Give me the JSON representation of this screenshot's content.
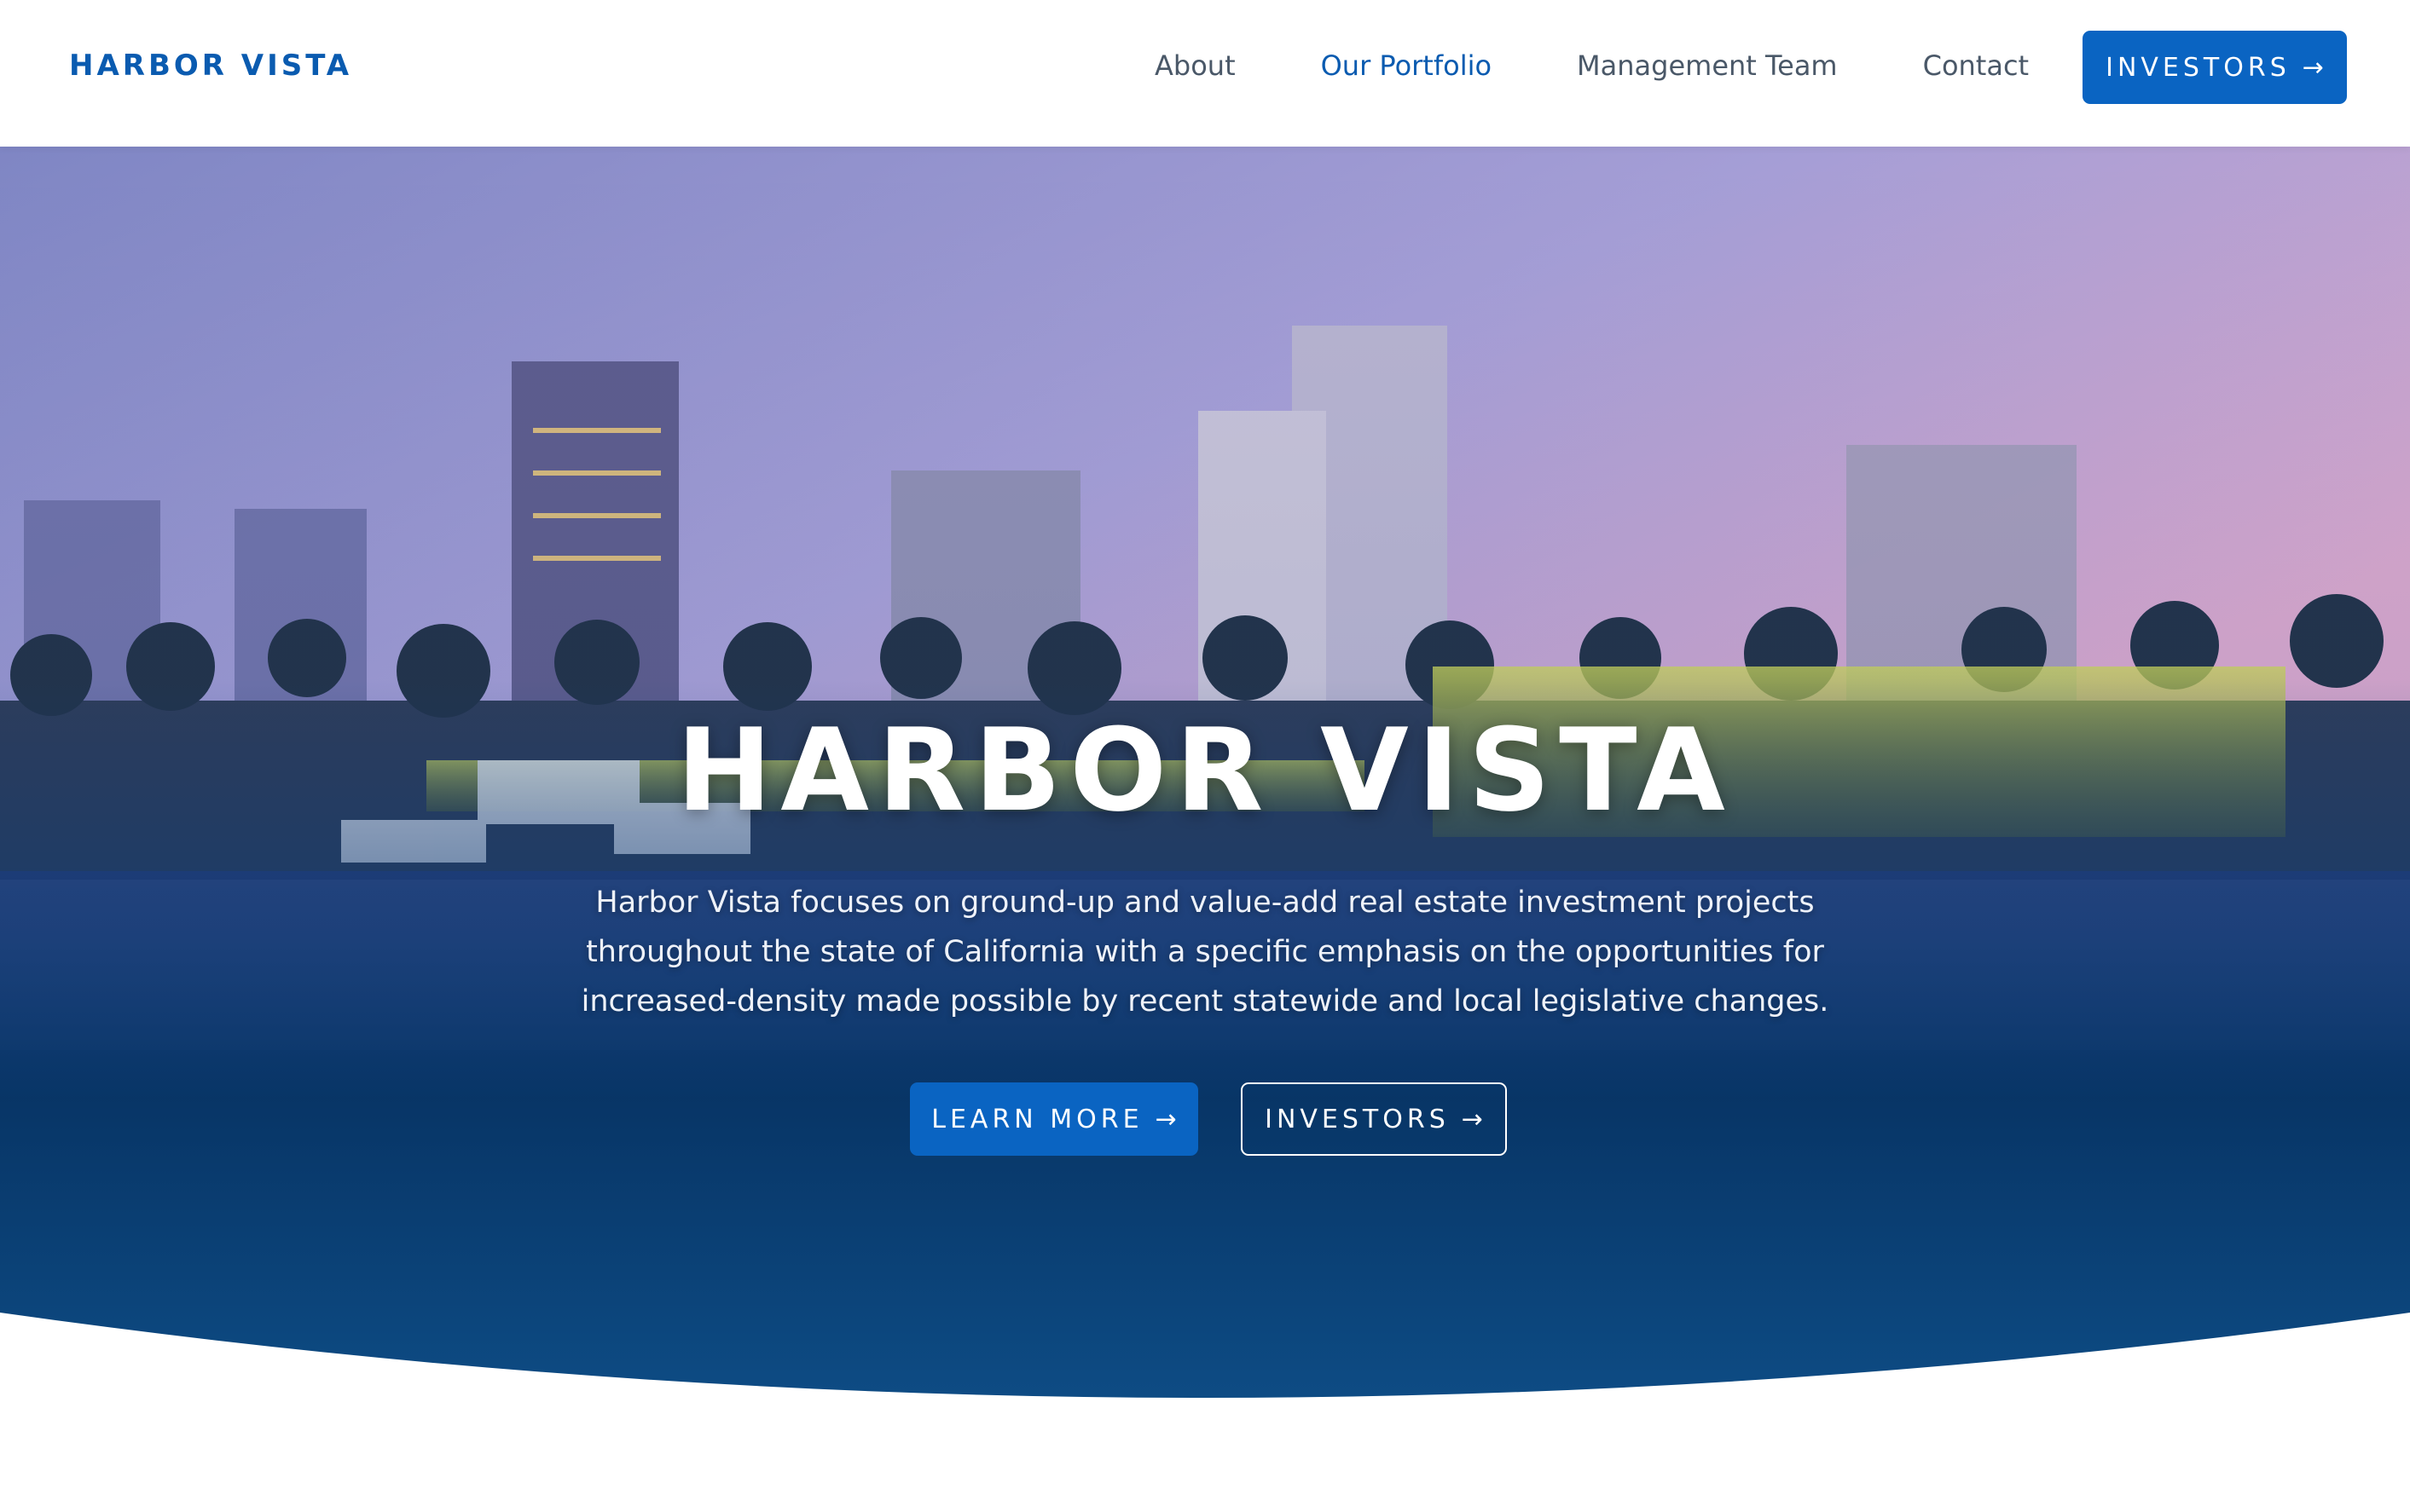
{
  "header": {
    "logo": "HARBOR VISTA",
    "nav": [
      {
        "label": "About"
      },
      {
        "label": "Our Portfolio"
      },
      {
        "label": "Management Team"
      },
      {
        "label": "Contact"
      }
    ],
    "cta_label": "INVESTORS",
    "cta_icon": "arrow-right-icon"
  },
  "hero": {
    "title": "HARBOR VISTA",
    "description": "Harbor Vista focuses on ground-up and value-add real estate investment projects throughout the state of California with a specific emphasis on the opportunities for increased-density made possible by recent statewide and local legislative changes.",
    "buttons": {
      "learn_more": "LEARN MORE",
      "investors": "INVESTORS"
    },
    "background": "city-skyline-waterfront-dusk-image"
  },
  "colors": {
    "brand": "#0a5bb0",
    "button": "#0a64c2",
    "nav_text": "#4a5868",
    "hero_bottom": "#0b3d72"
  }
}
